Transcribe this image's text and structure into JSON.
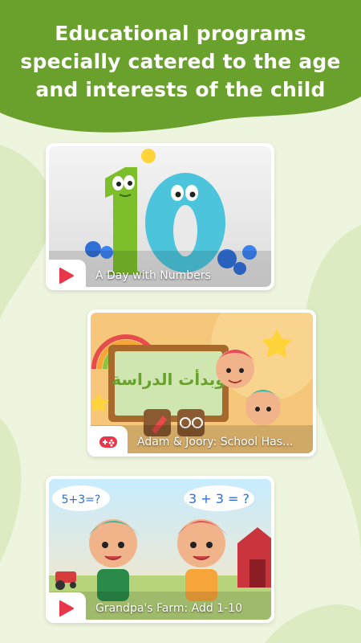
{
  "headline": {
    "line1": "Educational programs",
    "line2": "specially catered to the age",
    "line3": "and interests of the child"
  },
  "colors": {
    "header_green": "#6aa12c",
    "background": "#eef5df",
    "blob": "#dcebc2",
    "accent_red": "#e8364b"
  },
  "cards": [
    {
      "title": "A Day with Numbers",
      "icon": "play-icon"
    },
    {
      "title": "Adam & Joory: School Has...",
      "icon": "gamepad-icon",
      "artwork_text": "وبدأت الدراسة"
    },
    {
      "title": "Grandpa's Farm: Add 1-10",
      "icon": "play-icon",
      "bubble_left": "5+3=?",
      "bubble_right": "3 + 3 = ?"
    }
  ]
}
